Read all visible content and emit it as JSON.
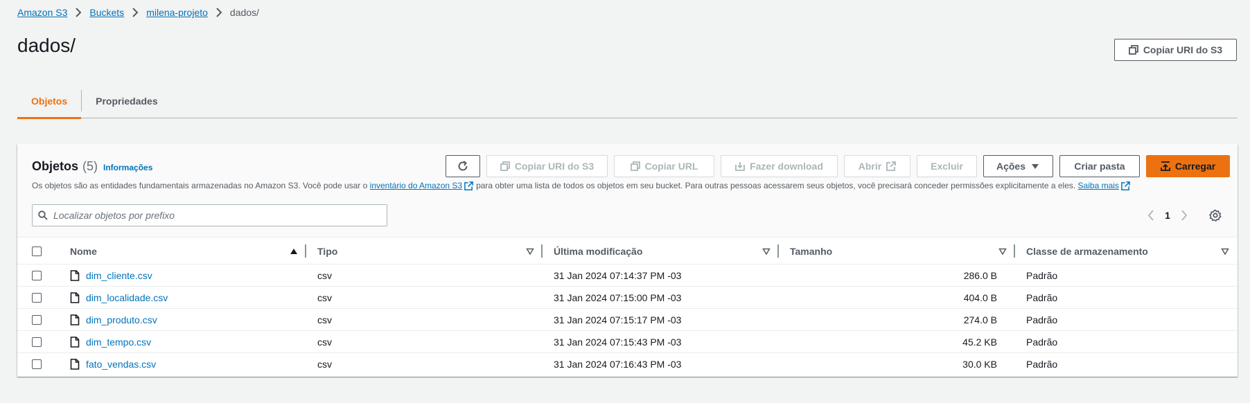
{
  "breadcrumb": {
    "items": [
      "Amazon S3",
      "Buckets",
      "milena-projeto"
    ],
    "current": "dados/"
  },
  "header": {
    "title": "dados/",
    "copy_uri_label": "Copiar URI do S3"
  },
  "tabs": [
    {
      "label": "Objetos",
      "active": true
    },
    {
      "label": "Propriedades",
      "active": false
    }
  ],
  "objects": {
    "title": "Objetos",
    "count": "(5)",
    "info_label": "Informações",
    "description": {
      "part1": "Os objetos são as entidades fundamentais armazenadas no Amazon S3. Você pode usar o",
      "inventory_link": "inventário do Amazon S3",
      "part2": "para obter uma lista de todos os objetos em seu bucket. Para outras pessoas acessarem seus objetos, você precisará conceder permissões explicitamente a eles.",
      "learn_more": "Saiba mais"
    },
    "actions": {
      "copy_uri": "Copiar URI do S3",
      "copy_url": "Copiar URL",
      "download": "Fazer download",
      "open": "Abrir",
      "delete": "Excluir",
      "actions_menu": "Ações",
      "create_folder": "Criar pasta",
      "upload": "Carregar"
    },
    "search": {
      "placeholder": "Localizar objetos por prefixo",
      "value": ""
    },
    "pagination": {
      "current_page": "1"
    },
    "table": {
      "columns": [
        "Nome",
        "Tipo",
        "Última modificação",
        "Tamanho",
        "Classe de armazenamento"
      ],
      "rows": [
        {
          "name": "dim_cliente.csv",
          "type": "csv",
          "modified": "31 Jan 2024 07:14:37 PM -03",
          "size": "286.0 B",
          "storage_class": "Padrão"
        },
        {
          "name": "dim_localidade.csv",
          "type": "csv",
          "modified": "31 Jan 2024 07:15:00 PM -03",
          "size": "404.0 B",
          "storage_class": "Padrão"
        },
        {
          "name": "dim_produto.csv",
          "type": "csv",
          "modified": "31 Jan 2024 07:15:17 PM -03",
          "size": "274.0 B",
          "storage_class": "Padrão"
        },
        {
          "name": "dim_tempo.csv",
          "type": "csv",
          "modified": "31 Jan 2024 07:15:43 PM -03",
          "size": "45.2 KB",
          "storage_class": "Padrão"
        },
        {
          "name": "fato_vendas.csv",
          "type": "csv",
          "modified": "31 Jan 2024 07:16:43 PM -03",
          "size": "30.0 KB",
          "storage_class": "Padrão"
        }
      ]
    }
  },
  "colors": {
    "accent": "#ec7211",
    "link": "#0073bb",
    "text": "#16191f",
    "muted": "#545b64",
    "background": "#f2f3f3"
  },
  "icons": [
    "chevron-right-icon",
    "copy-icon",
    "refresh-icon",
    "download-icon",
    "external-link-icon",
    "caret-down-icon",
    "upload-icon",
    "search-icon",
    "chevron-left-icon",
    "settings-icon",
    "file-icon",
    "sort-ascending-icon",
    "sort-icon"
  ]
}
